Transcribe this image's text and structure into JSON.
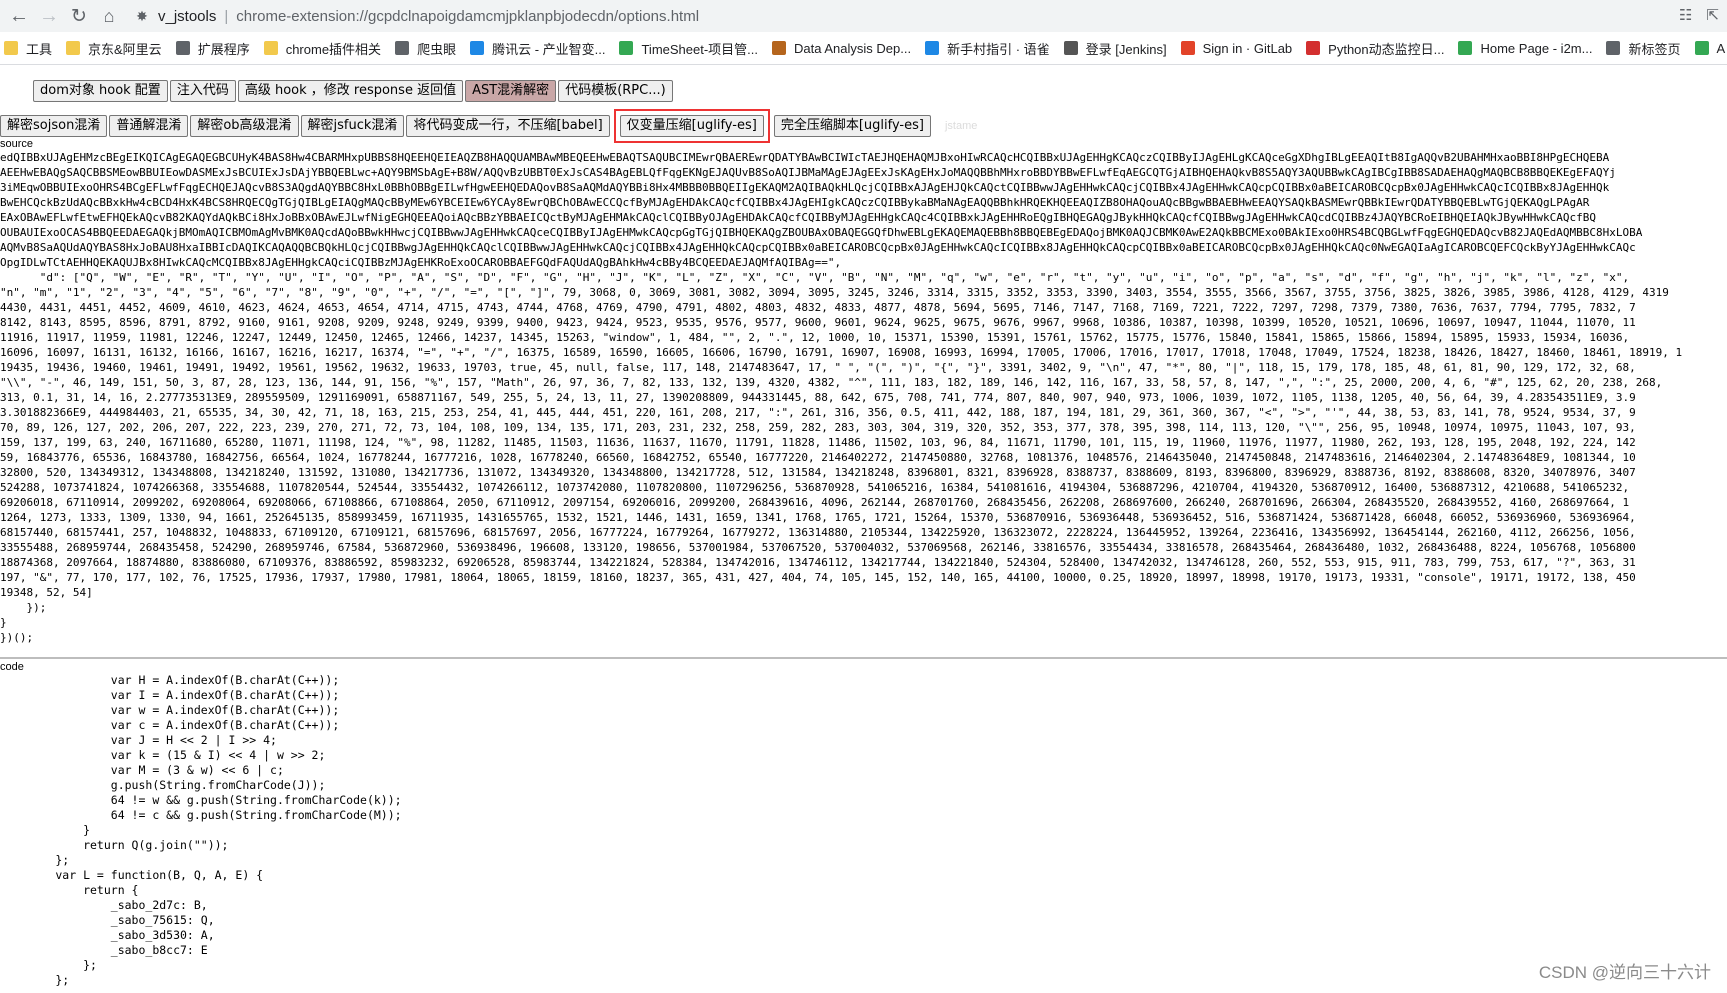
{
  "browser": {
    "ext_label": "v_jstools",
    "url": "chrome-extension://gcpdclnapoigdamcmjpklanpbjodecdn/options.html"
  },
  "bookmarks": [
    {
      "label": "工具",
      "color": "#f2c94c"
    },
    {
      "label": "京东&阿里云",
      "color": "#f2c94c"
    },
    {
      "label": "扩展程序",
      "color": "#5f6368"
    },
    {
      "label": "chrome插件相关",
      "color": "#f2c94c"
    },
    {
      "label": "爬虫眼",
      "color": "#5f6368"
    },
    {
      "label": "腾讯云 - 产业智变...",
      "color": "#1e88e5"
    },
    {
      "label": "TimeSheet-项目管...",
      "color": "#34a853"
    },
    {
      "label": "Data Analysis Dep...",
      "color": "#b5651d"
    },
    {
      "label": "新手村指引 · 语雀",
      "color": "#1e88e5"
    },
    {
      "label": "登录 [Jenkins]",
      "color": "#555555"
    },
    {
      "label": "Sign in · GitLab",
      "color": "#e24329"
    },
    {
      "label": "Python动态监控日...",
      "color": "#d32f2f"
    },
    {
      "label": "Home Page - i2m...",
      "color": "#34a853"
    },
    {
      "label": "新标签页",
      "color": "#5f6368"
    },
    {
      "label": "A",
      "color": "#34a853"
    }
  ],
  "toolbar1": [
    "dom对象 hook 配置",
    "注入代码",
    "高级 hook ，修改 response 返回值",
    "AST混淆解密",
    "代码模板(RPC...)"
  ],
  "toolbar2": [
    "解密sojson混淆",
    "普通解混淆",
    "解密ob高级混淆",
    "解密jsfuck混淆",
    "将代码变成一行，不压缩[babel]",
    "仅变量压缩[uglify-es]",
    "完全压缩脚本[uglify-es]"
  ],
  "faint_text": "jstame",
  "labels": {
    "source": "source",
    "code": "code"
  },
  "source_lines": [
    "edQIBBxUJAgEHMzcBEgEIKQICAgEGAQEGBCUHyK4BAS8Hw4CBARMHxpUBBS8HQEEHQEIEAQZB8HAQQUAMBAwMBEQEEHwEBAQTSAQUBCIMEwrQBAEREwrQDATYBAwBCIWIcTAEJHQEHAQMJBxoHIwRCAQcHCQIBBxUJAgEHHgKCAQczCQIBByIJAgEHLgKCAQceGgXDhgIBLgEEAQItB8IgAQQvB2UBAHMHxaoBBI8HPgECHQEBA",
    "AEEHwEBAQgSAQCBBSMEowBBUIEowDASMExJsBCUIExJsDAjYBBQEBLwc+AQY9BMSbAgE+B8W/AQQvBzUBBT0ExJsCAS4BAgEBLQfFqgEKNgEJAQUvB8SoAQIJBMaMAgEJAgEExJsKAgEHxJoMAQQBBhMHxroBBDYBBwEFLwfEqAEGCQTGjAIBHQEHAQkvB8S5AQY3AQUBBwkCAgIBCgIBB8SADAEHAQgMAQBCB8BBQEKEgEFAQYj",
    "3iMEqwOBBUIExoOHRS4BCgEFLwfFqgECHQEJAQcvB8S3AQgdAQYBBC8HxL0BBhOBBgEILwfHgwEEHQEDAQovB8SaAQMdAQYBBi8Hx4MBBB0BBQEIIgEKAQM2AQIBAQkHLQcjCQIBBxAJAgEHJQkCAQctCQIBBwwJAgEHHwkCAQcjCQIBBx4JAgEHHwkCAQcpCQIBBx0aBEICAROBCQcpBx0JAgEHHwkCAQcICQIBBx8JAgEHHQk",
    "BwEHCQckBzUdAQcBBxkHw4cBCD4HxK4BCS8HRQECQgTGjQIBLgEIAQgMAQcBByMEw6YBCEIEw6YCAy8EwrQBChOBAwECCQcfByMJAgEHDAkCAQcfCQIBBx4JAgEHIgkCAQczCQIBBykaBMaNAgEAQQBBhkHRQEKHQEEAQIZB8OHAQouAQcBBgwBBAEBHwEEAQYSAQkBASMEwrQBBkIEwrQDATYBBQEBLwTGjQEKAQgLPAgAR",
    "EAxOBAwEFLwfEtwEFHQEkAQcvB82KAQYdAQkBCi8HxJoBBxOBAwEJLwfNigEGHQEEAQoiAQcBBzYBBAEICQctByMJAgEHMAkCAQclCQIBByOJAgEHDAkCAQcfCQIBByMJAgEHHgkCAQc4CQIBBxkJAgEHHRoEQgIBHQEGAQgJBykHHQkCAQcfCQIBBwgJAgEHHwkCAQcdCQIBBz4JAQYBCRoEIBHQEIAQkJBywHHwkCAQcfBQ",
    "OUBAUIExoOCAS4BBQEEDAEGAQkjBMOmAQICBMOmAgMvBMK0AQcdAQoBBwkHHwcjCQIBBwwJAgEHHwkCAQceCQIBByIJAgEHMwkCAQcpGgTGjQIBHQEKAQgZBOUBAxOBAQEGGQfDhwEBLgEKAQEMAQEBBh8BBQEBEgEDAQojBMK0AQJCBMK0AwE2AQkBBCMExo0BAkIExo0HRS4BCQBGLwfFqgEGHQEDAQcvB82JAQEdAQMBBC8HxLOBA",
    "AQMvB8SaAQUdAQYBAS8HxJoBAU8HxaIBBIcDAQIKCAQAQQBCBQkHLQcjCQIBBwgJAgEHHQkCAQclCQIBBwwJAgEHHwkCAQcjCQIBBx4JAgEHHQkCAQcpCQIBBx0aBEICAROBCQcpBx0JAgEHHwkCAQcICQIBBx8JAgEHHQkCAQcpCQIBBx0aBEICAROBCQcpBx0JAgEHHQkCAQc0NwEGAQIaAgICAROBCQEFCQckByYJAgEHHwkCAQc",
    "OpgIDLwTCtAEHHQEKAQUJBx8HIwkCAQcMCQIBBx8JAgEHHgkCAQciCQIBBzMJAgEHKRoExoOCAROBBAEFGQdFAQUdAQgBAhkHw4cBBy4BCQEEDAEJAQMfAQIBAg==\",",
    "      \"d\": [\"Q\", \"W\", \"E\", \"R\", \"T\", \"Y\", \"U\", \"I\", \"O\", \"P\", \"A\", \"S\", \"D\", \"F\", \"G\", \"H\", \"J\", \"K\", \"L\", \"Z\", \"X\", \"C\", \"V\", \"B\", \"N\", \"M\", \"q\", \"w\", \"e\", \"r\", \"t\", \"y\", \"u\", \"i\", \"o\", \"p\", \"a\", \"s\", \"d\", \"f\", \"g\", \"h\", \"j\", \"k\", \"l\", \"z\", \"x\",",
    "\"n\", \"m\", \"1\", \"2\", \"3\", \"4\", \"5\", \"6\", \"7\", \"8\", \"9\", \"0\", \"+\", \"/\", \"=\", \"[\", \"]\", 79, 3068, 0, 3069, 3081, 3082, 3094, 3095, 3245, 3246, 3314, 3315, 3352, 3353, 3390, 3403, 3554, 3555, 3566, 3567, 3755, 3756, 3825, 3826, 3985, 3986, 4128, 4129, 4319",
    "4430, 4431, 4451, 4452, 4609, 4610, 4623, 4624, 4653, 4654, 4714, 4715, 4743, 4744, 4768, 4769, 4790, 4791, 4802, 4803, 4832, 4833, 4877, 4878, 5694, 5695, 7146, 7147, 7168, 7169, 7221, 7222, 7297, 7298, 7379, 7380, 7636, 7637, 7794, 7795, 7832, 7",
    "8142, 8143, 8595, 8596, 8791, 8792, 9160, 9161, 9208, 9209, 9248, 9249, 9399, 9400, 9423, 9424, 9523, 9535, 9576, 9577, 9600, 9601, 9624, 9625, 9675, 9676, 9967, 9968, 10386, 10387, 10398, 10399, 10520, 10521, 10696, 10697, 10947, 11044, 11070, 11",
    "11916, 11917, 11959, 11981, 12246, 12247, 12449, 12450, 12465, 12466, 14237, 14345, 15263, \"window\", 1, 484, \"\", 2, \".\", 12, 1000, 10, 15371, 15390, 15391, 15761, 15762, 15775, 15776, 15840, 15841, 15865, 15866, 15894, 15895, 15933, 15934, 16036,",
    "16096, 16097, 16131, 16132, 16166, 16167, 16216, 16217, 16374, \"=\", \"+\", \"/\", 16375, 16589, 16590, 16605, 16606, 16790, 16791, 16907, 16908, 16993, 16994, 17005, 17006, 17016, 17017, 17018, 17048, 17049, 17524, 18238, 18426, 18427, 18460, 18461, 18919, 1",
    "19435, 19436, 19460, 19461, 19491, 19492, 19561, 19562, 19632, 19633, 19703, true, 45, null, false, 117, 148, 2147483647, 17, \" \", \"(\", \")\", \"{\", \"}\", 3391, 3402, 9, \"\\n\", 47, \"*\", 80, \"|\", 118, 15, 179, 178, 185, 48, 61, 81, 90, 129, 172, 32, 68,",
    "\"\\\\\", \"-\", 46, 149, 151, 50, 3, 87, 28, 123, 136, 144, 91, 156, \"%\", 157, \"Math\", 26, 97, 36, 7, 82, 133, 132, 139, 4320, 4382, \"^\", 111, 183, 182, 189, 146, 142, 116, 167, 33, 58, 57, 8, 147, \",\", \":\", 25, 2000, 200, 4, 6, \"#\", 125, 62, 20, 238, 268,",
    "313, 0.1, 31, 14, 16, 2.277735313E9, 289559509, 1291169091, 658871167, 549, 255, 5, 24, 13, 11, 27, 1390208809, 944331445, 88, 642, 675, 708, 741, 774, 807, 840, 907, 940, 973, 1006, 1039, 1072, 1105, 1138, 1205, 40, 56, 64, 39, 4.283543511E9, 3.9",
    "3.301882366E9, 444984403, 21, 65535, 34, 30, 42, 71, 18, 163, 215, 253, 254, 41, 445, 444, 451, 220, 161, 208, 217, \":\", 261, 316, 356, 0.5, 411, 442, 188, 187, 194, 181, 29, 361, 360, 367, \"<\", \">\", \"'\", 44, 38, 53, 83, 141, 78, 9524, 9534, 37, 9",
    "70, 89, 126, 127, 202, 206, 207, 222, 223, 239, 270, 271, 72, 73, 104, 108, 109, 134, 135, 171, 203, 231, 232, 258, 259, 282, 283, 303, 304, 319, 320, 352, 353, 377, 378, 395, 398, 114, 113, 120, \"\\\"\", 256, 95, 10948, 10974, 10975, 11043, 107, 93,",
    "159, 137, 199, 63, 240, 16711680, 65280, 11071, 11198, 124, \"%\", 98, 11282, 11485, 11503, 11636, 11637, 11670, 11791, 11828, 11486, 11502, 103, 96, 84, 11671, 11790, 101, 115, 19, 11960, 11976, 11977, 11980, 262, 193, 128, 195, 2048, 192, 224, 142",
    "59, 16843776, 65536, 16843780, 16842756, 66564, 1024, 16778244, 16777216, 1028, 16778240, 66560, 16842752, 65540, 16777220, 2146402272, 2147450880, 32768, 1081376, 1048576, 2146435040, 2147450848, 2147483616, 2146402304, 2.147483648E9, 1081344, 10",
    "32800, 520, 134349312, 134348808, 134218240, 131592, 131080, 134217736, 131072, 134349320, 134348800, 134217728, 512, 131584, 134218248, 8396801, 8321, 8396928, 8388737, 8388609, 8193, 8396800, 8396929, 8388736, 8192, 8388608, 8320, 34078976, 3407",
    "524288, 1073741824, 1074266368, 33554688, 1107820544, 524544, 33554432, 1074266112, 1073742080, 1107820800, 1107296256, 536870928, 541065216, 16384, 541081616, 4194304, 536887296, 4210704, 4194320, 536870912, 16400, 536887312, 4210688, 541065232,",
    "69206018, 67110914, 2099202, 69208064, 69208066, 67108866, 67108864, 2050, 67110912, 2097154, 69206016, 2099200, 268439616, 4096, 262144, 268701760, 268435456, 262208, 268697600, 266240, 268701696, 266304, 268435520, 268439552, 4160, 268697664, 1",
    "1264, 1273, 1333, 1309, 1330, 94, 1661, 252645135, 858993459, 16711935, 1431655765, 1532, 1521, 1446, 1431, 1659, 1341, 1768, 1765, 1721, 15264, 15370, 536870916, 536936448, 536936452, 516, 536871424, 536871428, 66048, 66052, 536936960, 536936964,",
    "68157440, 68157441, 257, 1048832, 1048833, 67109120, 67109121, 68157696, 68157697, 2056, 16777224, 16779264, 16779272, 136314880, 2105344, 134225920, 136323072, 2228224, 136445952, 139264, 2236416, 134356992, 136454144, 262160, 4112, 266256, 1056,",
    "33555488, 268959744, 268435458, 524290, 268959746, 67584, 536872960, 536938496, 196608, 133120, 198656, 537001984, 537067520, 537004032, 537069568, 262146, 33816576, 33554434, 33816578, 268435464, 268436480, 1032, 268436488, 8224, 1056768, 1056800",
    "18874368, 2097664, 18874880, 83886080, 67109376, 83886592, 85983232, 69206528, 85983744, 134221824, 528384, 134742016, 134746112, 134217744, 134221840, 524304, 528400, 134742032, 134746128, 260, 552, 553, 915, 911, 783, 799, 753, 617, \"?\", 363, 31",
    "197, \"&\", 77, 170, 177, 102, 76, 17525, 17936, 17937, 17980, 17981, 18064, 18065, 18159, 18160, 18237, 365, 431, 427, 404, 74, 105, 145, 152, 140, 165, 44100, 10000, 0.25, 18920, 18997, 18998, 19170, 19173, 19331, \"console\", 19171, 19172, 138, 450",
    "19348, 52, 54]",
    "    });",
    "}",
    "})();"
  ],
  "code_lines": [
    "                var H = A.indexOf(B.charAt(C++));",
    "                var I = A.indexOf(B.charAt(C++));",
    "                var w = A.indexOf(B.charAt(C++));",
    "                var c = A.indexOf(B.charAt(C++));",
    "                var J = H << 2 | I >> 4;",
    "                var k = (15 & I) << 4 | w >> 2;",
    "                var M = (3 & w) << 6 | c;",
    "                g.push(String.fromCharCode(J));",
    "                64 != w && g.push(String.fromCharCode(k));",
    "                64 != c && g.push(String.fromCharCode(M));",
    "            }",
    "            return Q(g.join(\"\"));",
    "        };",
    "        var L = function(B, Q, A, E) {",
    "            return {",
    "                _sabo_2d7c: B,",
    "                _sabo_75615: Q,",
    "                _sabo_3d530: A,",
    "                _sabo_b8cc7: E",
    "            };",
    "        };"
  ],
  "watermark": "CSDN @逆向三十六计"
}
